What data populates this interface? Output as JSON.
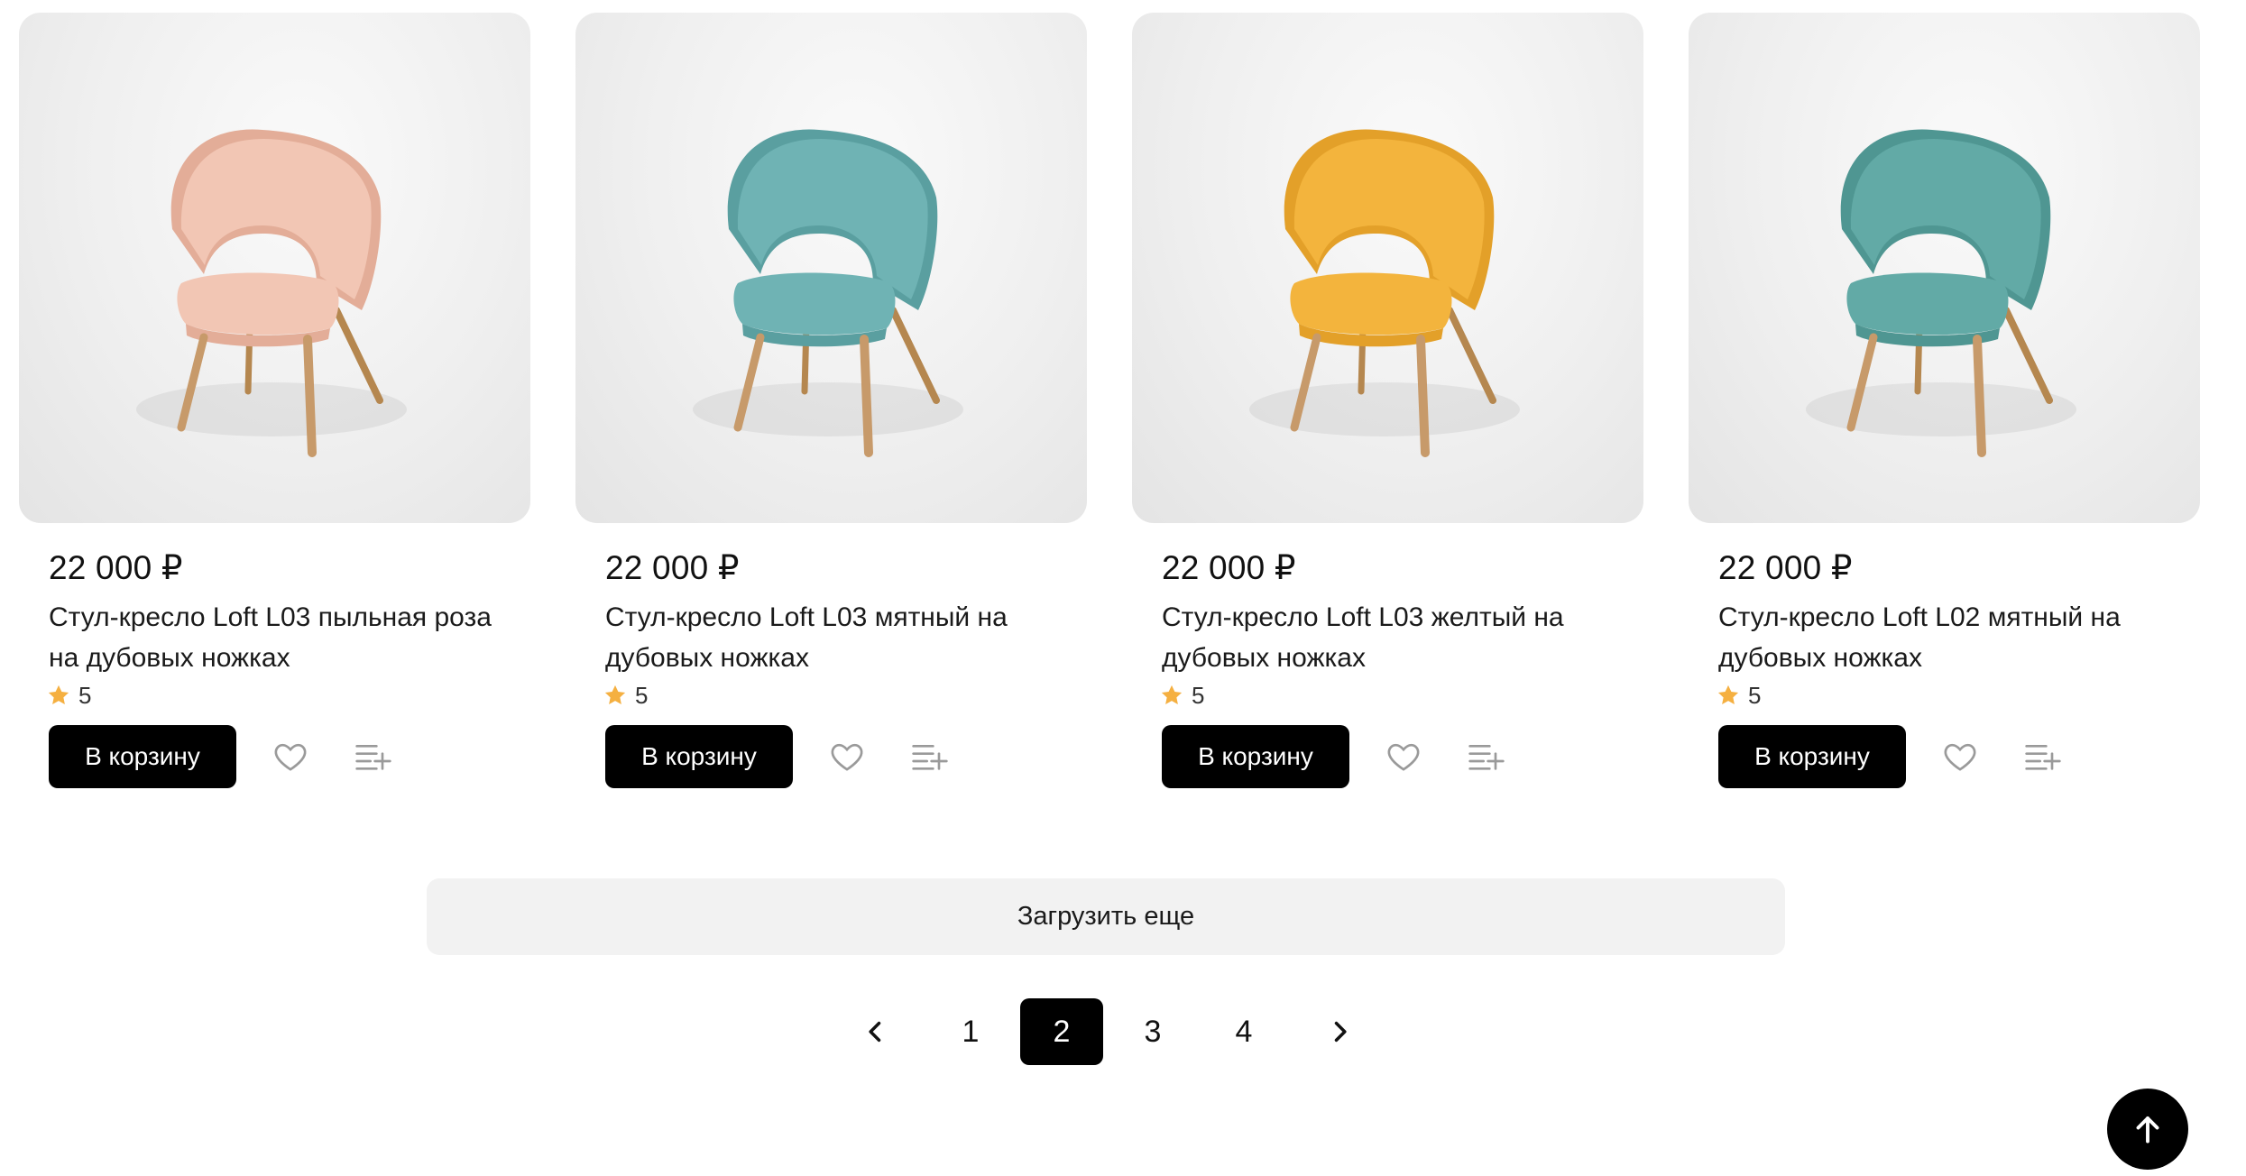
{
  "products": [
    {
      "price": "22 000 ₽",
      "title": "Стул-кресло Loft L03 пыльная роза на дубовых ножках",
      "rating": "5",
      "cart_label": "В корзину",
      "color": "#f2c6b4",
      "color_dark": "#e3ad98"
    },
    {
      "price": "22 000 ₽",
      "title": "Стул-кресло Loft L03 мятный на дубовых ножках",
      "rating": "5",
      "cart_label": "В корзину",
      "color": "#6fb3b4",
      "color_dark": "#5a9fa0"
    },
    {
      "price": "22 000 ₽",
      "title": "Стул-кресло Loft L03 желтый на дубовых ножках",
      "rating": "5",
      "cart_label": "В корзину",
      "color": "#f3b43d",
      "color_dark": "#e3a029"
    },
    {
      "price": "22 000 ₽",
      "title": "Стул-кресло Loft L02 мятный на дубовых ножках",
      "rating": "5",
      "cart_label": "В корзину",
      "color": "#62aaa6",
      "color_dark": "#4f9692"
    }
  ],
  "load_more_label": "Загрузить еще",
  "pagination": {
    "pages": [
      "1",
      "2",
      "3",
      "4"
    ],
    "active": "2"
  },
  "icons": {
    "favorite": "heart-icon",
    "compare": "compare-list-icon",
    "rating": "star-icon",
    "prev": "chevron-left-icon",
    "next": "chevron-right-icon",
    "scroll_top": "arrow-up-icon"
  },
  "colors": {
    "accent": "#000000",
    "star": "#f5b041",
    "icon_gray": "#9a9a9a",
    "load_more_bg": "#f2f2f2"
  }
}
